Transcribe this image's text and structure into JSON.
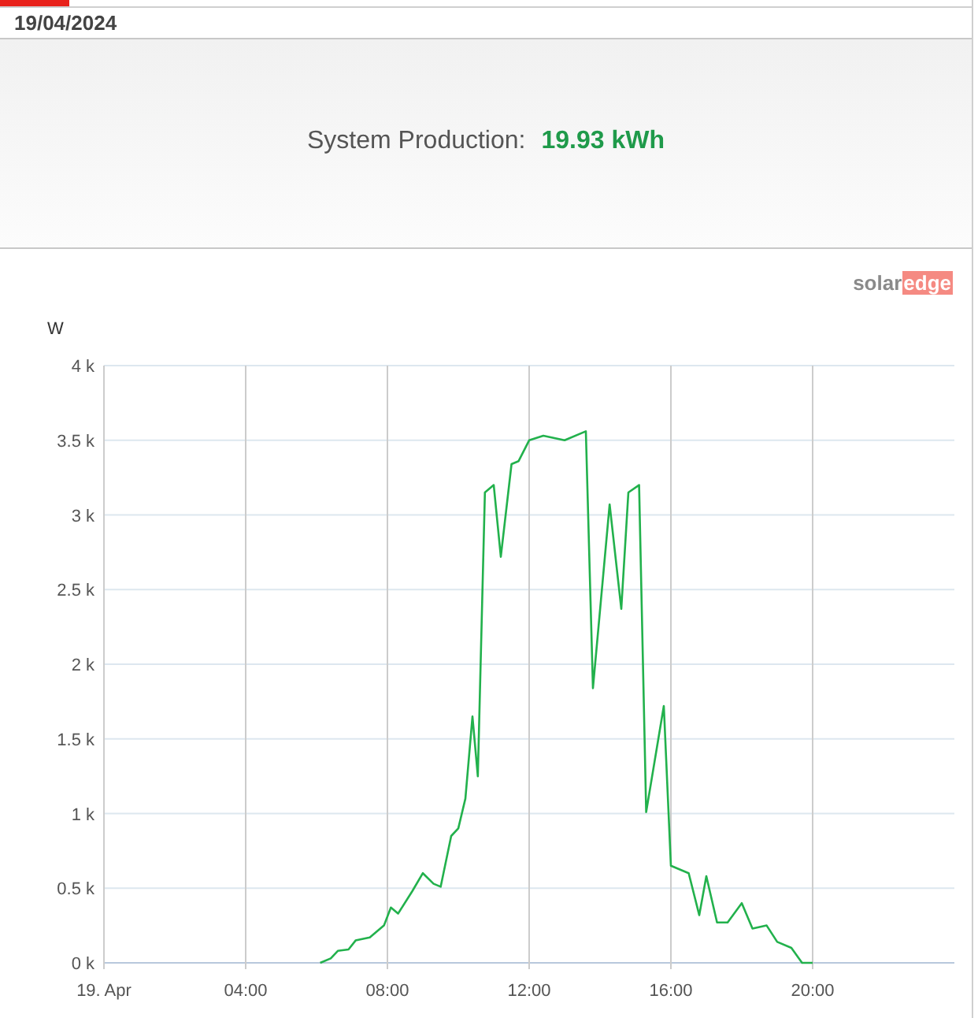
{
  "date": "19/04/2024",
  "summary": {
    "label": "System Production:",
    "value": "19.93 kWh"
  },
  "logo": {
    "part_1": "solar",
    "part_2": "edge"
  },
  "chart": {
    "chart_data": {
      "type": "line",
      "grid": true,
      "ylabel": "W",
      "xlim": [
        0,
        24
      ],
      "ylim": [
        0,
        4000
      ],
      "x": [
        6.1,
        6.4,
        6.6,
        6.9,
        7.1,
        7.5,
        7.9,
        8.1,
        8.3,
        8.7,
        9.0,
        9.3,
        9.5,
        9.8,
        10.0,
        10.2,
        10.4,
        10.55,
        10.75,
        11.0,
        11.2,
        11.5,
        11.7,
        12.0,
        12.4,
        13.0,
        13.6,
        13.8,
        14.27,
        14.6,
        14.8,
        15.1,
        15.3,
        15.8,
        16.0,
        16.5,
        16.8,
        17.0,
        17.3,
        17.6,
        18.0,
        18.3,
        18.7,
        19.0,
        19.4,
        19.7,
        20.0
      ],
      "series": [
        {
          "color": "#22b14c",
          "values": [
            0,
            30,
            80,
            90,
            150,
            170,
            250,
            370,
            330,
            480,
            600,
            530,
            510,
            850,
            900,
            1100,
            1650,
            1250,
            3150,
            3200,
            2720,
            3340,
            3360,
            3500,
            3530,
            3500,
            3560,
            1840,
            3070,
            2370,
            3150,
            3200,
            1010,
            1720,
            650,
            600,
            320,
            580,
            270,
            270,
            400,
            230,
            250,
            140,
            100,
            0,
            0
          ]
        }
      ],
      "xticks": [
        {
          "value": 0,
          "label": "19. Apr"
        },
        {
          "value": 4,
          "label": "04:00"
        },
        {
          "value": 8,
          "label": "08:00"
        },
        {
          "value": 12,
          "label": "12:00"
        },
        {
          "value": 16,
          "label": "16:00"
        },
        {
          "value": 20,
          "label": "20:00"
        }
      ],
      "yticks": [
        {
          "value": 0,
          "label": "0 k"
        },
        {
          "value": 500,
          "label": "0.5 k"
        },
        {
          "value": 1000,
          "label": "1 k"
        },
        {
          "value": 1500,
          "label": "1.5 k"
        },
        {
          "value": 2000,
          "label": "2 k"
        },
        {
          "value": 2500,
          "label": "2.5 k"
        },
        {
          "value": 3000,
          "label": "3 k"
        },
        {
          "value": 3500,
          "label": "3.5 k"
        },
        {
          "value": 4000,
          "label": "4 k"
        }
      ]
    }
  }
}
